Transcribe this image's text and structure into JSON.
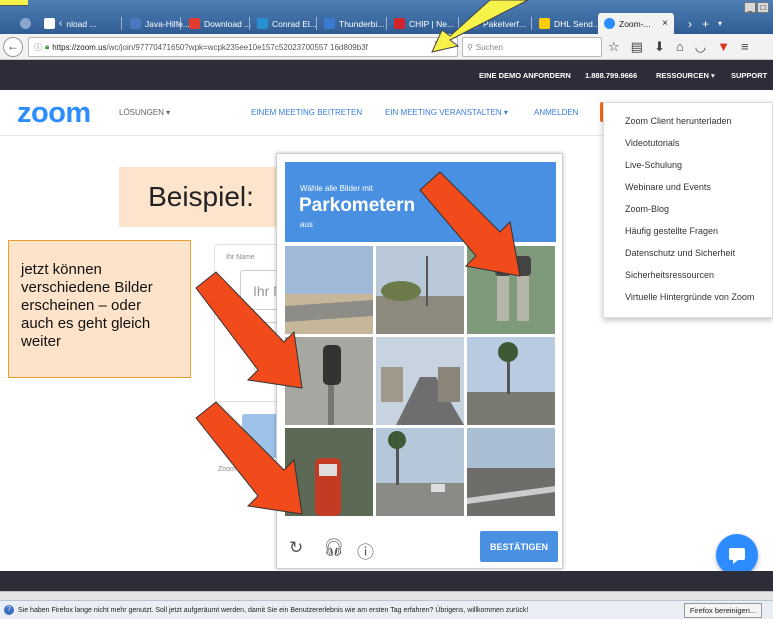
{
  "browser": {
    "tabs": [
      {
        "label": "nload ...",
        "color": "#6b8fc7"
      },
      {
        "label": "Java-Hilfe...",
        "color": "#4a78c0"
      },
      {
        "label": "Download ...",
        "color": "#e23b2e"
      },
      {
        "label": "Conrad El...",
        "color": "#2a8fd0"
      },
      {
        "label": "Thunderbi...",
        "color": "#3b7ad1"
      },
      {
        "label": "CHIP | Ne...",
        "color": "#d2232a"
      },
      {
        "label": "Paketverf...",
        "color": "#4b74b8"
      },
      {
        "label": "DHL Send...",
        "color": "#ffcc00"
      },
      {
        "label": "Zoom-...",
        "color": "#2d8cff"
      }
    ],
    "tab_close": "×",
    "new_tab": "+",
    "url_prefix": "https://zoom.us",
    "url_path": "/wc/join/97770471650?wpk=wcpk235ee10e157c52023700557 16d809b3f",
    "search_placeholder": "Suchen"
  },
  "zoom_topbar": {
    "demo": "EINE DEMO ANFORDERN",
    "phone": "1.888.799.9666",
    "resources": "RESSOURCEN ▾",
    "support": "SUPPORT"
  },
  "zoom_header": {
    "logo": "zoom",
    "solutions": "LÖSUNGEN ▾",
    "join": "EINEM MEETING BEITRETEN",
    "host": "EIN MEETING VERANSTALTEN ▾",
    "signin": "ANMELDEN"
  },
  "dropdown": [
    "Zoom Client herunterladen",
    "Videotutorials",
    "Live-Schulung",
    "Webinare und Events",
    "Zoom-Blog",
    "Häufig gestellte Fragen",
    "Datenschutz und Sicherheit",
    "Sicherheitsressourcen",
    "Virtuelle Hintergründe von Zoom"
  ],
  "annotations": {
    "beispiel": "Beispiel:",
    "note_lines": [
      "jetzt können",
      "verschiedene Bilder",
      "erscheinen – oder",
      "auch es geht gleich",
      "weiter"
    ]
  },
  "join_form": {
    "name_label": "Ihr Name",
    "name_placeholder": "Ihr N",
    "terms_prefix": "Zoom ist g"
  },
  "captcha": {
    "pre": "Wähle alle Bilder mit",
    "word": "Parkometern",
    "post": "aus",
    "verify": "BESTÄTIGEN",
    "header_color": "#4a90e2",
    "footer_icons": [
      "reload-icon",
      "headphones-icon",
      "info-icon"
    ]
  },
  "notification": {
    "text": "Sie haben Firefox lange nicht mehr genutzt. Soll jetzt aufgeräumt werden, damit Sie ein Benutzererlebnis wie am ersten Tag erfahren? Übrigens, willkommen zurück!",
    "button": "Firefox bereinigen..."
  }
}
